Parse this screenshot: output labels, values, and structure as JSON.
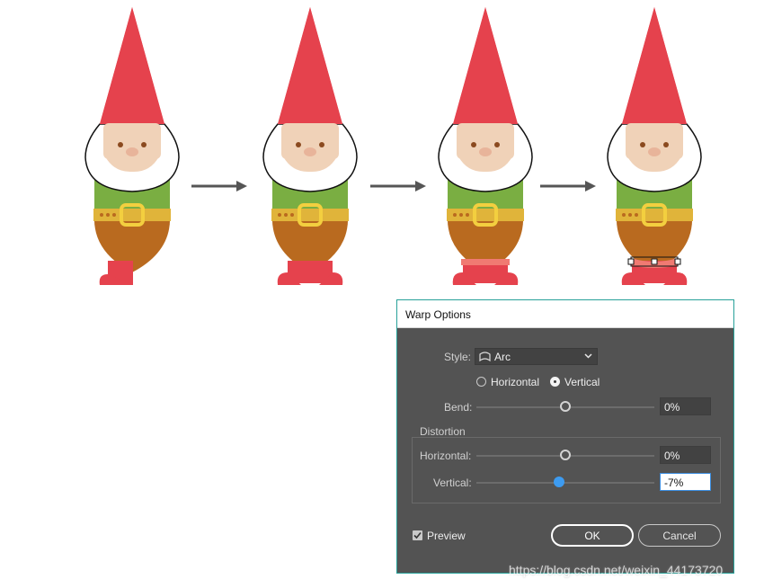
{
  "dialog": {
    "title": "Warp Options",
    "style_label": "Style:",
    "style_value": "Arc",
    "orientation": {
      "horizontal_label": "Horizontal",
      "vertical_label": "Vertical",
      "selected": "Vertical"
    },
    "bend": {
      "label": "Bend:",
      "value": "0%",
      "level": 0
    },
    "distortion": {
      "group_label": "Distortion",
      "horizontal": {
        "label": "Horizontal:",
        "value": "0%",
        "level": 0
      },
      "vertical": {
        "label": "Vertical:",
        "value": "-7%",
        "level": -7
      }
    },
    "preview": {
      "label": "Preview",
      "checked": true
    },
    "ok_label": "OK",
    "cancel_label": "Cancel"
  },
  "watermark": "https://blog.csdn.net/weixin_44173720",
  "colors": {
    "hat": "#e5424d",
    "shirt": "#7aae42",
    "belt": "#e0b43a",
    "pants": "#b96a1f",
    "boots": "#e5424d",
    "dialog_bg": "#535353",
    "accent": "#3d9bf0"
  }
}
